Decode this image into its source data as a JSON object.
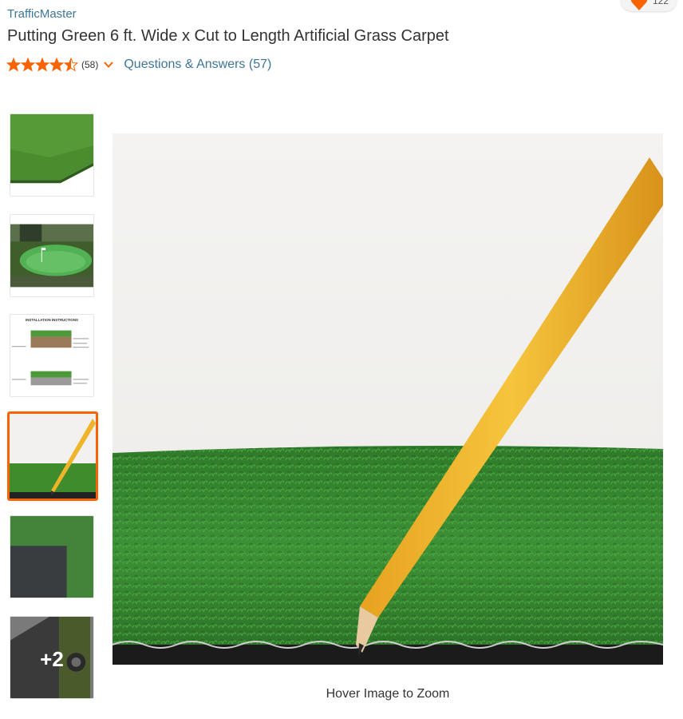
{
  "product": {
    "brand": "TrafficMaster",
    "title": "Putting Green 6 ft. Wide x Cut to Length Artificial Grass Carpet",
    "rating": 4.5,
    "review_count": "(58)",
    "qa_link": "Questions & Answers (57)",
    "favorite_count": "122"
  },
  "gallery": {
    "thumbnails": [
      {
        "subject": "grass-roll-corner",
        "selected": false
      },
      {
        "subject": "backyard-putting-green",
        "selected": false
      },
      {
        "subject": "installation-instructions",
        "selected": false,
        "text": "INSTALLATION INSTRUCTIONS"
      },
      {
        "subject": "pencil-on-grass",
        "selected": true
      },
      {
        "subject": "grass-backing-detail",
        "selected": false
      },
      {
        "subject": "rolls-more",
        "selected": false,
        "more_label": "+2"
      }
    ],
    "zoom_hint": "Hover Image to Zoom"
  },
  "colors": {
    "link": "#3e7697",
    "accent": "#f96302",
    "star": "#f96302"
  }
}
